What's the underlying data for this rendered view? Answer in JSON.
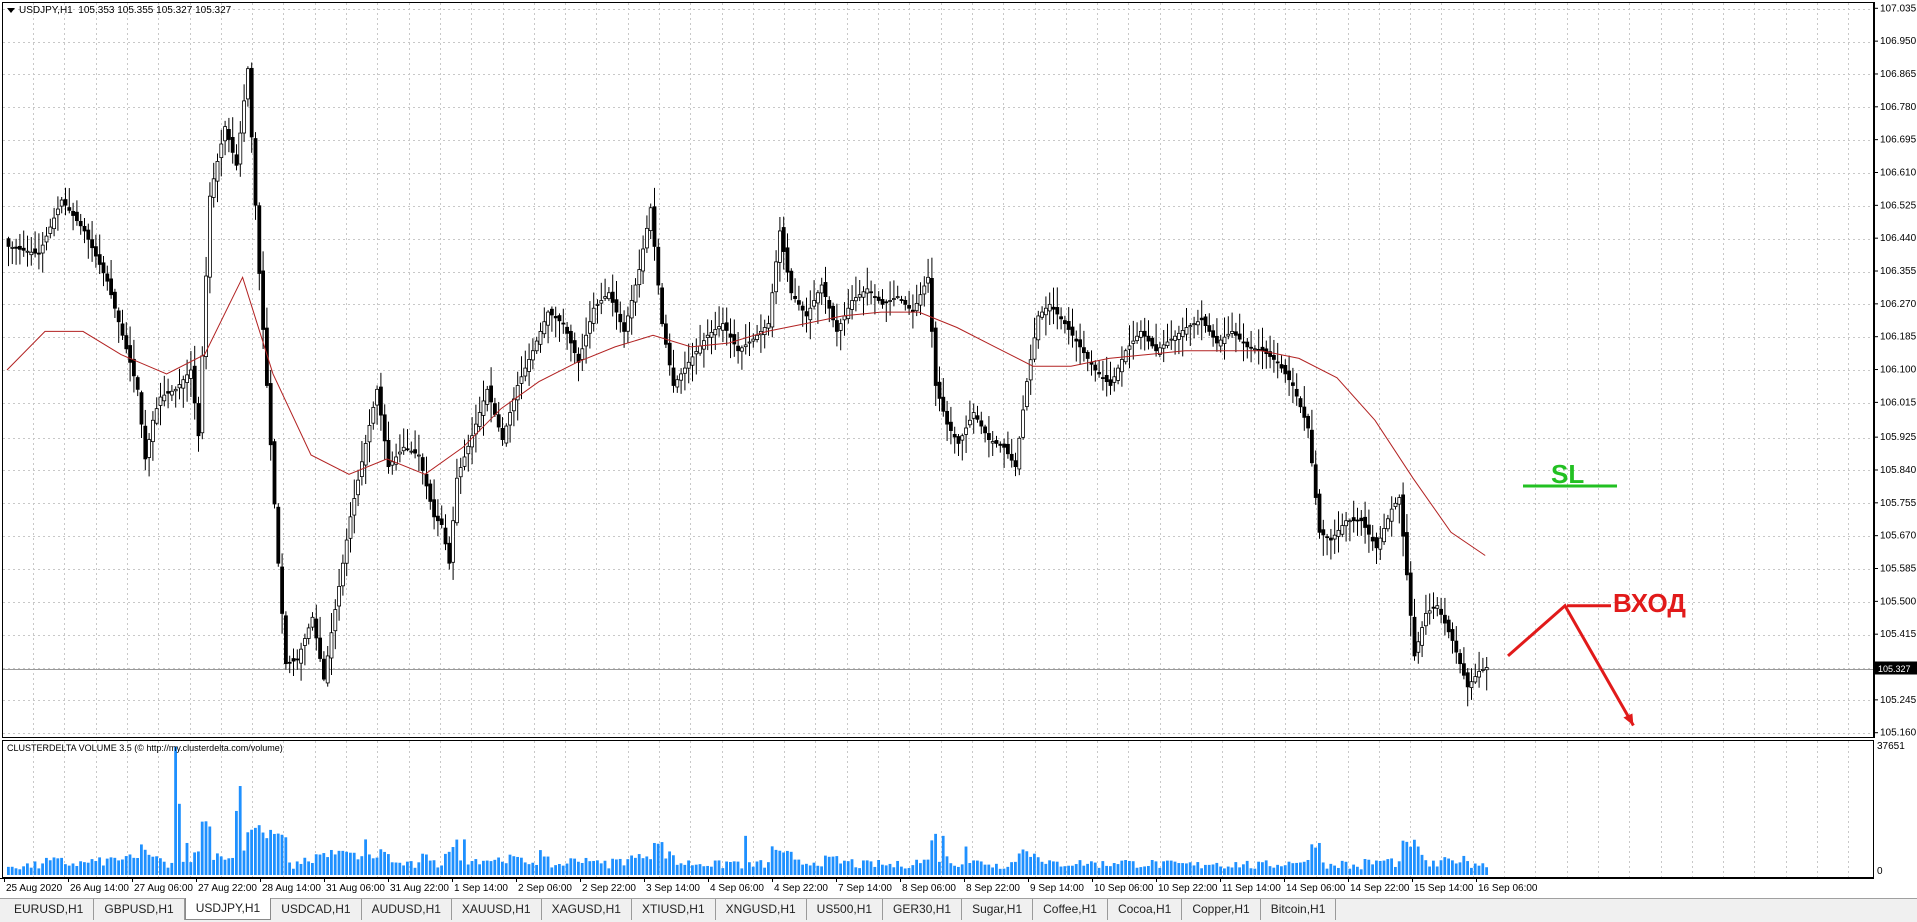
{
  "chart_header": {
    "symbol": "USDJPY,H1",
    "ohlc": "105.353 105.355 105.327 105.327"
  },
  "indicator_header": "CLUSTERDELTA VOLUME 3.5 (© http://my.clusterdelta.com/volume)",
  "annotations": {
    "sl_label": "SL",
    "entry_label": "ВХОД",
    "sl_color": "#22c022",
    "entry_color": "#e11a1a"
  },
  "current_price_label": "105.327",
  "volume_scale": {
    "top": "37651",
    "bottom": "0"
  },
  "tabs": [
    {
      "label": "EURUSD,H1",
      "active": false
    },
    {
      "label": "GBPUSD,H1",
      "active": false
    },
    {
      "label": "USDJPY,H1",
      "active": true
    },
    {
      "label": "USDCAD,H1",
      "active": false
    },
    {
      "label": "AUDUSD,H1",
      "active": false
    },
    {
      "label": "XAUUSD,H1",
      "active": false
    },
    {
      "label": "XAGUSD,H1",
      "active": false
    },
    {
      "label": "XTIUSD,H1",
      "active": false
    },
    {
      "label": "XNGUSD,H1",
      "active": false
    },
    {
      "label": "US500,H1",
      "active": false
    },
    {
      "label": "GER30,H1",
      "active": false
    },
    {
      "label": "Sugar,H1",
      "active": false
    },
    {
      "label": "Coffee,H1",
      "active": false
    },
    {
      "label": "Cocoa,H1",
      "active": false
    },
    {
      "label": "Copper,H1",
      "active": false
    },
    {
      "label": "Bitcoin,H1",
      "active": false
    }
  ],
  "chart_data": {
    "type": "candlestick",
    "symbol": "USDJPY",
    "timeframe": "H1",
    "y_ticks": [
      "107.035",
      "106.950",
      "106.865",
      "106.780",
      "106.695",
      "106.610",
      "106.525",
      "106.440",
      "106.355",
      "106.270",
      "106.185",
      "106.100",
      "106.015",
      "105.925",
      "105.840",
      "105.755",
      "105.670",
      "105.585",
      "105.500",
      "105.415",
      "105.330",
      "105.245",
      "105.160"
    ],
    "ylim": [
      105.145,
      107.05
    ],
    "x_ticks": [
      "25 Aug 2020",
      "26 Aug 14:00",
      "27 Aug 06:00",
      "27 Aug 22:00",
      "28 Aug 14:00",
      "31 Aug 06:00",
      "31 Aug 22:00",
      "1 Sep 14:00",
      "2 Sep 06:00",
      "2 Sep 22:00",
      "3 Sep 14:00",
      "4 Sep 06:00",
      "4 Sep 22:00",
      "7 Sep 14:00",
      "8 Sep 06:00",
      "8 Sep 22:00",
      "9 Sep 14:00",
      "10 Sep 06:00",
      "10 Sep 22:00",
      "11 Sep 14:00",
      "14 Sep 06:00",
      "14 Sep 22:00",
      "15 Sep 14:00",
      "16 Sep 06:00"
    ],
    "close_path": [
      [
        0,
        106.42
      ],
      [
        8,
        106.4
      ],
      [
        14,
        106.54
      ],
      [
        20,
        106.46
      ],
      [
        26,
        106.33
      ],
      [
        30,
        106.19
      ],
      [
        34,
        106.05
      ],
      [
        36,
        105.87
      ],
      [
        38,
        105.97
      ],
      [
        40,
        106.03
      ],
      [
        44,
        106.05
      ],
      [
        48,
        106.1
      ],
      [
        50,
        105.93
      ],
      [
        53,
        106.55
      ],
      [
        57,
        106.73
      ],
      [
        60,
        106.63
      ],
      [
        63,
        106.88
      ],
      [
        66,
        106.35
      ],
      [
        68,
        106.06
      ],
      [
        71,
        105.6
      ],
      [
        73,
        105.34
      ],
      [
        76,
        105.35
      ],
      [
        80,
        105.46
      ],
      [
        83,
        105.3
      ],
      [
        86,
        105.48
      ],
      [
        90,
        105.72
      ],
      [
        94,
        105.91
      ],
      [
        97,
        106.05
      ],
      [
        100,
        105.85
      ],
      [
        104,
        105.9
      ],
      [
        108,
        105.88
      ],
      [
        112,
        105.72
      ],
      [
        114,
        105.7
      ],
      [
        116,
        105.6
      ],
      [
        118,
        105.82
      ],
      [
        122,
        105.93
      ],
      [
        126,
        106.05
      ],
      [
        130,
        105.92
      ],
      [
        134,
        106.06
      ],
      [
        138,
        106.15
      ],
      [
        142,
        106.25
      ],
      [
        146,
        106.22
      ],
      [
        150,
        106.12
      ],
      [
        154,
        106.26
      ],
      [
        158,
        106.3
      ],
      [
        162,
        106.2
      ],
      [
        166,
        106.36
      ],
      [
        169,
        106.52
      ],
      [
        172,
        106.22
      ],
      [
        175,
        106.06
      ],
      [
        179,
        106.12
      ],
      [
        184,
        106.19
      ],
      [
        188,
        106.22
      ],
      [
        192,
        106.15
      ],
      [
        196,
        106.18
      ],
      [
        200,
        106.22
      ],
      [
        203,
        106.46
      ],
      [
        206,
        106.3
      ],
      [
        210,
        106.24
      ],
      [
        214,
        106.32
      ],
      [
        218,
        106.2
      ],
      [
        222,
        106.28
      ],
      [
        226,
        106.31
      ],
      [
        230,
        106.27
      ],
      [
        234,
        106.29
      ],
      [
        238,
        106.25
      ],
      [
        242,
        106.34
      ],
      [
        244,
        106.06
      ],
      [
        247,
        105.96
      ],
      [
        250,
        105.91
      ],
      [
        254,
        105.99
      ],
      [
        258,
        105.92
      ],
      [
        262,
        105.9
      ],
      [
        265,
        105.85
      ],
      [
        268,
        106.07
      ],
      [
        271,
        106.24
      ],
      [
        274,
        106.27
      ],
      [
        278,
        106.22
      ],
      [
        282,
        106.16
      ],
      [
        286,
        106.1
      ],
      [
        290,
        106.06
      ],
      [
        294,
        106.15
      ],
      [
        298,
        106.2
      ],
      [
        302,
        106.15
      ],
      [
        306,
        106.18
      ],
      [
        310,
        106.21
      ],
      [
        314,
        106.23
      ],
      [
        318,
        106.17
      ],
      [
        322,
        106.2
      ],
      [
        326,
        106.16
      ],
      [
        330,
        106.15
      ],
      [
        334,
        106.12
      ],
      [
        338,
        106.06
      ],
      [
        342,
        105.95
      ],
      [
        345,
        105.68
      ],
      [
        348,
        105.66
      ],
      [
        352,
        105.71
      ],
      [
        356,
        105.71
      ],
      [
        360,
        105.64
      ],
      [
        364,
        105.74
      ],
      [
        366,
        105.77
      ],
      [
        368,
        105.57
      ],
      [
        370,
        105.36
      ],
      [
        373,
        105.47
      ],
      [
        376,
        105.49
      ],
      [
        380,
        105.4
      ],
      [
        384,
        105.28
      ],
      [
        387,
        105.32
      ],
      [
        389,
        105.33
      ]
    ],
    "ma_line": {
      "name": "",
      "color": "#b22222",
      "points": [
        [
          0,
          106.1
        ],
        [
          10,
          106.2
        ],
        [
          20,
          106.2
        ],
        [
          30,
          106.14
        ],
        [
          42,
          106.09
        ],
        [
          52,
          106.14
        ],
        [
          62,
          106.34
        ],
        [
          70,
          106.09
        ],
        [
          80,
          105.88
        ],
        [
          90,
          105.83
        ],
        [
          100,
          105.87
        ],
        [
          110,
          105.83
        ],
        [
          120,
          105.9
        ],
        [
          130,
          106.0
        ],
        [
          140,
          106.07
        ],
        [
          150,
          106.12
        ],
        [
          160,
          106.16
        ],
        [
          170,
          106.19
        ],
        [
          180,
          106.16
        ],
        [
          190,
          106.17
        ],
        [
          200,
          106.2
        ],
        [
          210,
          106.22
        ],
        [
          220,
          106.24
        ],
        [
          230,
          106.25
        ],
        [
          240,
          106.25
        ],
        [
          250,
          106.21
        ],
        [
          260,
          106.16
        ],
        [
          270,
          106.11
        ],
        [
          280,
          106.11
        ],
        [
          290,
          106.13
        ],
        [
          300,
          106.14
        ],
        [
          310,
          106.15
        ],
        [
          320,
          106.15
        ],
        [
          330,
          106.15
        ],
        [
          340,
          106.13
        ],
        [
          350,
          106.08
        ],
        [
          360,
          105.97
        ],
        [
          370,
          105.82
        ],
        [
          380,
          105.68
        ],
        [
          389,
          105.62
        ]
      ]
    },
    "current_price": 105.327,
    "volume_indicator": {
      "name": "CLUSTERDELTA VOLUME 3.5",
      "ylim": [
        0,
        37651
      ],
      "spikes": [
        [
          44,
          36000
        ],
        [
          45,
          20000
        ],
        [
          47,
          9000
        ],
        [
          60,
          18000
        ],
        [
          61,
          25000
        ],
        [
          63,
          12000
        ],
        [
          66,
          14000
        ],
        [
          94,
          10000
        ],
        [
          120,
          10000
        ],
        [
          140,
          7000
        ],
        [
          170,
          9000
        ],
        [
          194,
          11000
        ],
        [
          246,
          11000
        ],
        [
          252,
          8000
        ],
        [
          270,
          6000
        ],
        [
          345,
          9000
        ],
        [
          371,
          8000
        ]
      ]
    },
    "drawings": {
      "sl_level": 105.8,
      "entry_level": 105.49,
      "entry_path": [
        [
          395,
          105.36
        ],
        [
          410,
          105.49
        ],
        [
          428,
          105.18
        ]
      ]
    }
  }
}
